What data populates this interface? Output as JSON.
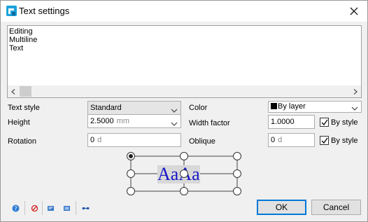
{
  "window": {
    "title": "Text settings",
    "icon": "app-logo-icon",
    "close_icon": "close-icon"
  },
  "preview": {
    "lines": [
      "Editing",
      "Multiline",
      "Text"
    ]
  },
  "form": {
    "text_style": {
      "label": "Text style",
      "value": "Standard"
    },
    "height": {
      "label": "Height",
      "value": "2.5000",
      "unit": "mm"
    },
    "rotation": {
      "label": "Rotation",
      "value": "0",
      "unit": "d"
    },
    "color": {
      "label": "Color",
      "value": "By layer",
      "swatch": "#000000"
    },
    "width_factor": {
      "label": "Width factor",
      "value": "1.0000",
      "by_style_label": "By style",
      "by_style_checked": true
    },
    "oblique": {
      "label": "Oblique",
      "value": "0",
      "unit": "d",
      "by_style_label": "By style",
      "by_style_checked": true
    }
  },
  "alignment": {
    "sample_text": "AaAa",
    "selected": "top-left",
    "sample_color": "#1616c8"
  },
  "toolbar": {
    "icons": [
      "help-icon",
      "no-style-icon",
      "insert-field-icon",
      "text-properties-icon",
      "link-icon"
    ]
  },
  "buttons": {
    "ok": "OK",
    "cancel": "Cancel"
  }
}
